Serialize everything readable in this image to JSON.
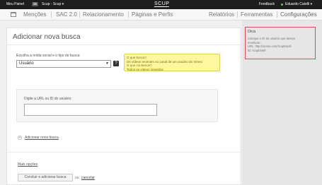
{
  "topbar": {
    "panel_label": "Meu Painel",
    "account_label": "Scup - Scup ▾",
    "logo": "SCUP",
    "feedback": "Feedback",
    "user": "Eduardo Catelli ▾"
  },
  "nav": {
    "items": [
      "Menções",
      "SAC 2.0",
      "Relacionamento",
      "Páginas e Perfis"
    ],
    "right_items": [
      "Relatórios",
      "Ferramentas",
      "Configurações"
    ]
  },
  "form": {
    "title": "Adicionar nova busca",
    "select_label": "Escolha a mídia social e o tipo de busca:",
    "select_value": "Usuário",
    "help_icon": "?",
    "tip_q1": "O que busca?",
    "tip_a1": "Os vídeos recentes no canal de um usuário do Vimeo",
    "tip_q2": "O que contamos?",
    "tip_a2": "Todos os vídeos inseridos",
    "url_label": "Digite a URL ou ID do usuário:",
    "url_value": "",
    "add_search": "Adicionar nova busca",
    "more_options": "Mais opções",
    "submit": "Concluir e adicionar busca",
    "or": "ou",
    "cancel": "cancelar"
  },
  "hint": {
    "title": "Dica",
    "line1": "Coloque o ID do usuário que deseja",
    "line2": "monitorar:",
    "line3": "URL: http://vimeo.com/scupbrasil",
    "line4": "ID: scupbrasil"
  },
  "colors": {
    "topbar": "#1e1e1e",
    "tip_bg": "#fff6a0",
    "hint_border": "#d94a5a",
    "online": "#6bc26b"
  }
}
